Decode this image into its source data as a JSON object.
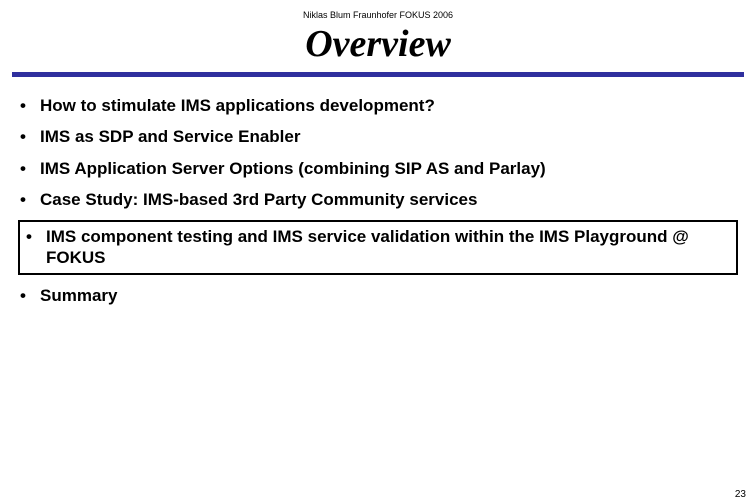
{
  "header": {
    "attribution": "Niklas Blum Fraunhofer FOKUS 2006",
    "title": "Overview"
  },
  "bullets": {
    "b1": "How to stimulate IMS applications development?",
    "b2": "IMS as SDP and Service Enabler",
    "b3": "IMS Application Server Options (combining SIP AS and Parlay)",
    "b4": "Case Study: IMS-based 3rd Party Community services",
    "b5": "IMS component testing and IMS service validation within the IMS Playground @ FOKUS",
    "b6": "Summary"
  },
  "page_number": "23",
  "dot": "•"
}
